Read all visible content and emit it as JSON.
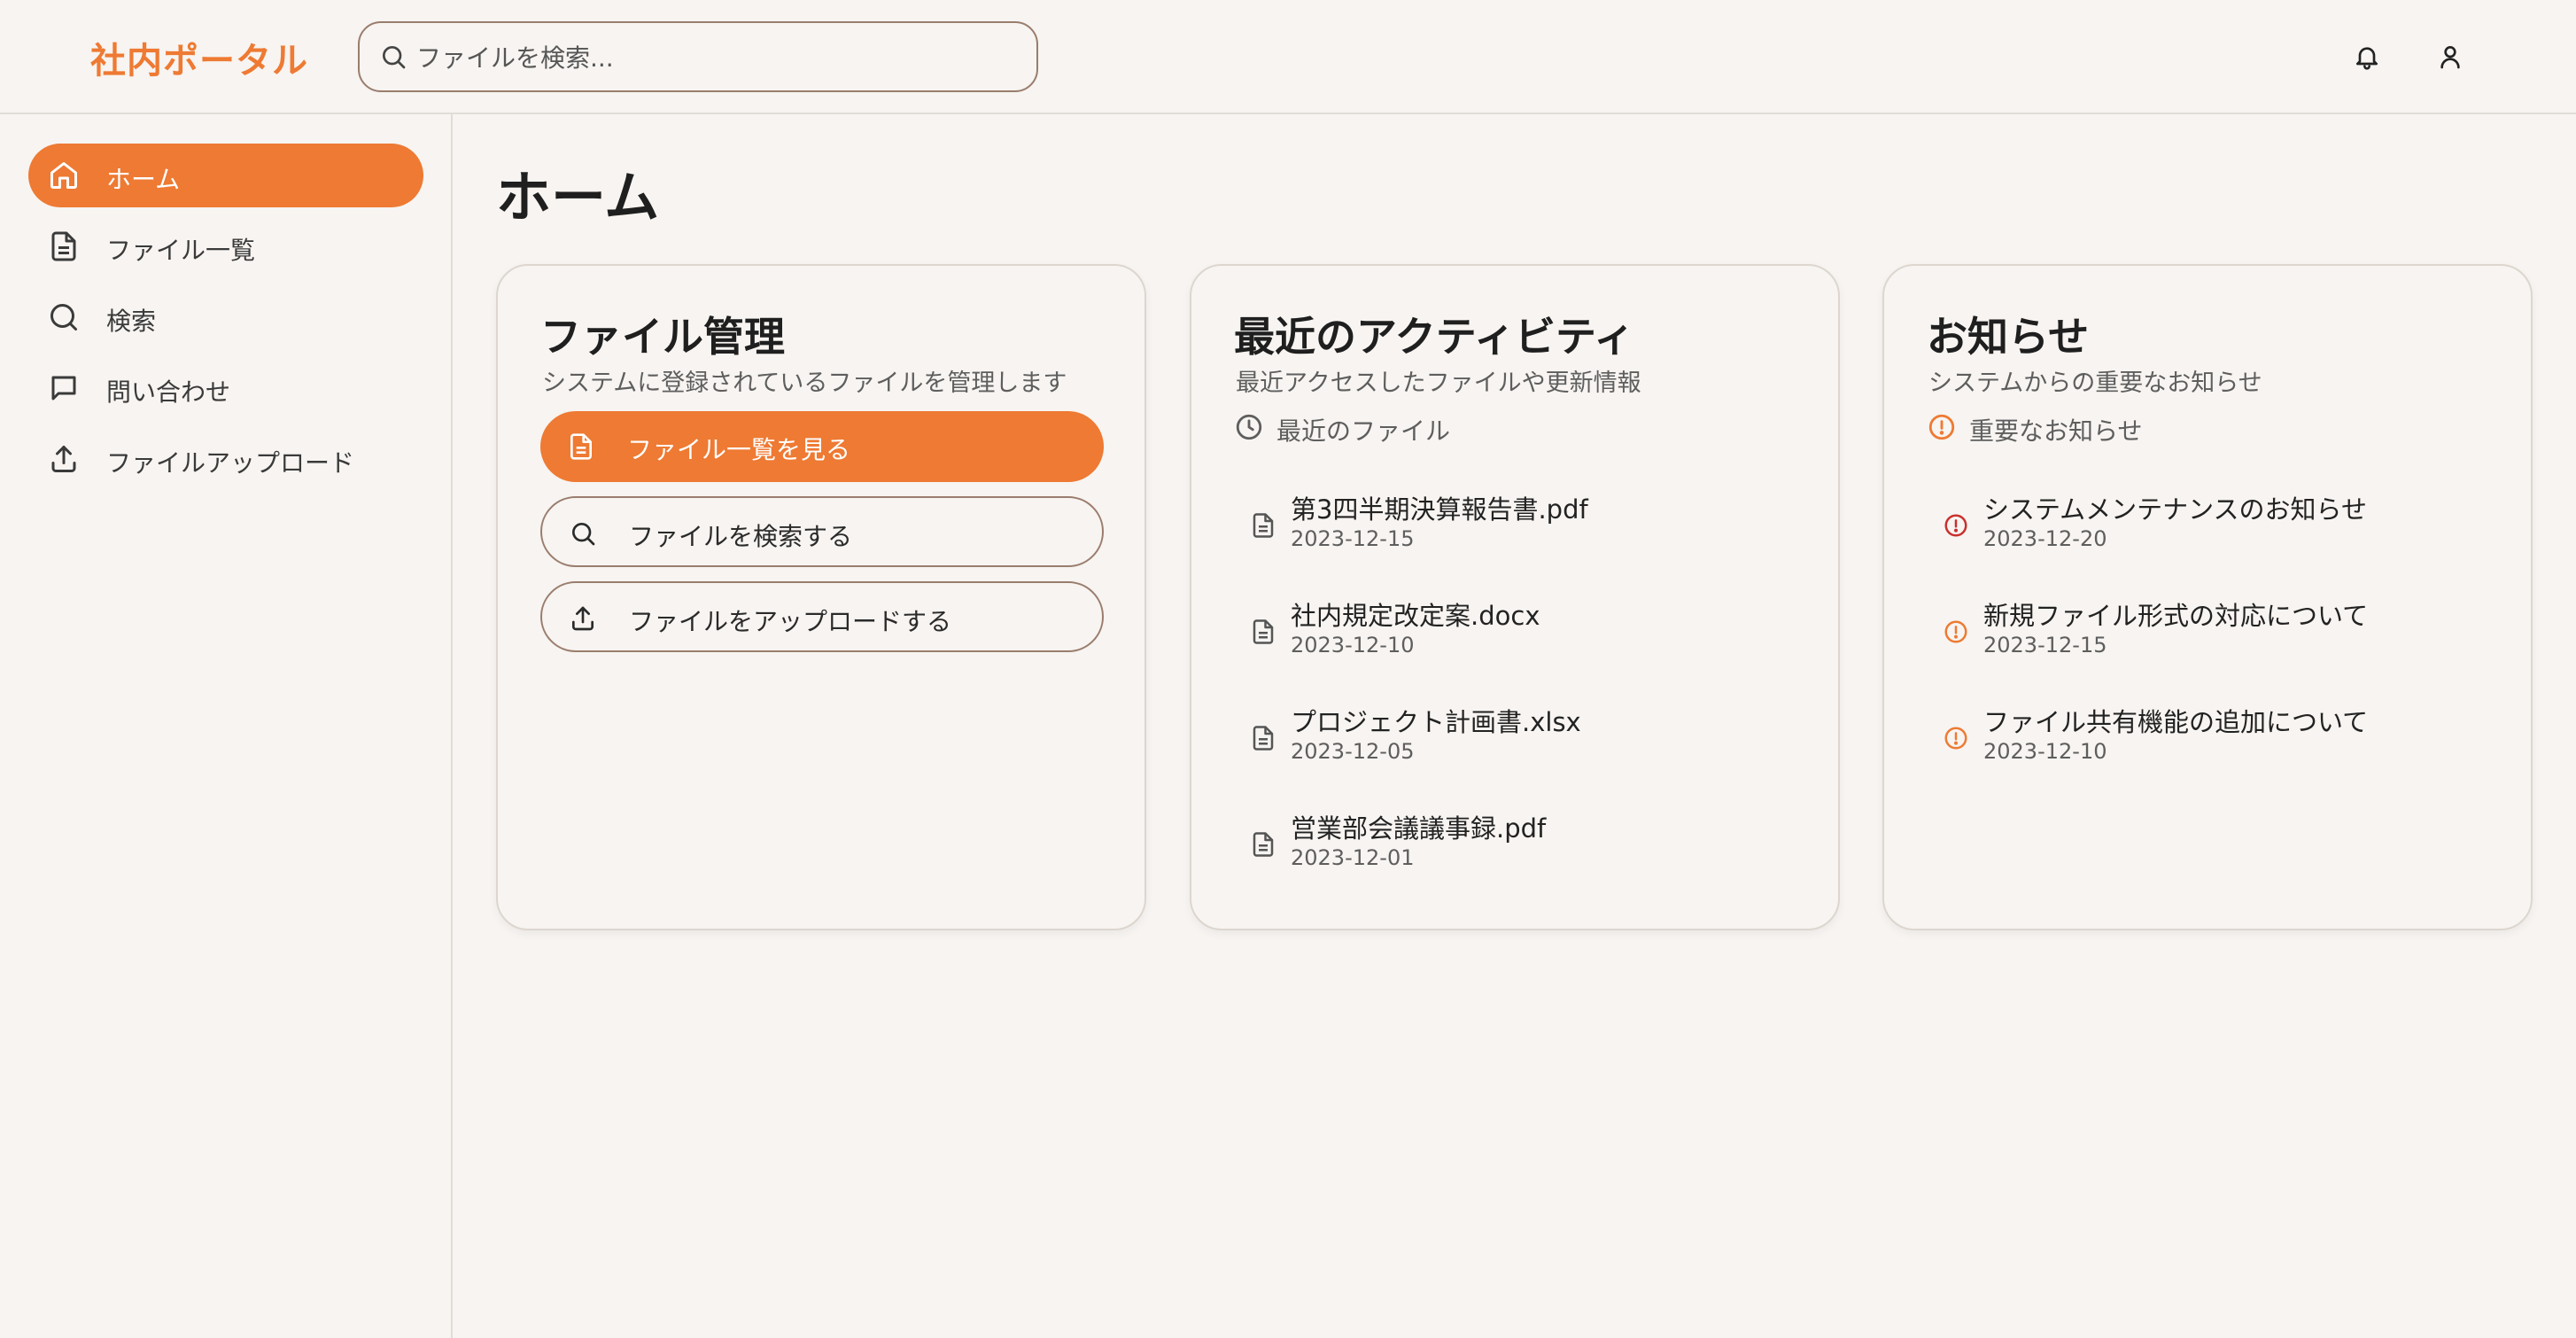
{
  "app": {
    "logo": "社内ポータル"
  },
  "search": {
    "placeholder": "ファイルを検索..."
  },
  "header": {
    "icons": [
      "bell-icon",
      "user-icon"
    ]
  },
  "sidebar": {
    "items": [
      {
        "label": "ホーム",
        "icon": "home-icon",
        "active": true
      },
      {
        "label": "ファイル一覧",
        "icon": "file-text-icon",
        "active": false
      },
      {
        "label": "検索",
        "icon": "search-icon",
        "active": false
      },
      {
        "label": "問い合わせ",
        "icon": "message-icon",
        "active": false
      },
      {
        "label": "ファイルアップロード",
        "icon": "upload-icon",
        "active": false
      }
    ]
  },
  "main": {
    "title": "ホーム",
    "file_card": {
      "title": "ファイル管理",
      "subtitle": "システムに登録されているファイルを管理します",
      "buttons": [
        {
          "label": "ファイル一覧を見る",
          "icon": "file-text-icon"
        },
        {
          "label": "ファイルを検索する",
          "icon": "search-icon"
        },
        {
          "label": "ファイルをアップロードする",
          "icon": "upload-icon"
        }
      ]
    },
    "activity_card": {
      "title": "最近のアクティビティ",
      "subtitle": "最近アクセスしたファイルや更新情報",
      "section_label": "最近のファイル",
      "files": [
        {
          "name": "第3四半期決算報告書.pdf",
          "date": "2023-12-15"
        },
        {
          "name": "社内規定改定案.docx",
          "date": "2023-12-10"
        },
        {
          "name": "プロジェクト計画書.xlsx",
          "date": "2023-12-05"
        },
        {
          "name": "営業部会議議事録.pdf",
          "date": "2023-12-01"
        }
      ]
    },
    "notice_card": {
      "title": "お知らせ",
      "subtitle": "システムからの重要なお知らせ",
      "section_label": "重要なお知らせ",
      "notices": [
        {
          "title": "システムメンテナンスのお知らせ",
          "date": "2023-12-20",
          "color": "#c9302c"
        },
        {
          "title": "新規ファイル形式の対応について",
          "date": "2023-12-15",
          "color": "#ee7a33"
        },
        {
          "title": "ファイル共有機能の追加について",
          "date": "2023-12-10",
          "color": "#ee7a33"
        }
      ]
    }
  },
  "colors": {
    "accent": "#ee7a33",
    "danger": "#c9302c",
    "background": "#f7f4f1"
  }
}
